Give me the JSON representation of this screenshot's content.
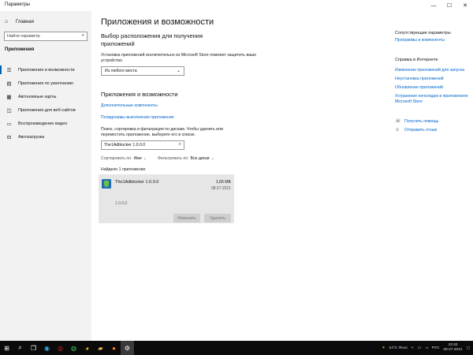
{
  "window": {
    "title": "Параметры",
    "minimize": "—",
    "maximize": "☐",
    "close": "✕"
  },
  "sidebar": {
    "home": "Главная",
    "search_placeholder": "Найти параметр",
    "section": "Приложения",
    "items": [
      {
        "label": "Приложения и возможности",
        "icon": "list-icon",
        "glyph": "☰",
        "active": true
      },
      {
        "label": "Приложения по умолчанию",
        "icon": "default-apps-icon",
        "glyph": "▤"
      },
      {
        "label": "Автономные карты",
        "icon": "map-icon",
        "glyph": "▦"
      },
      {
        "label": "Приложения для веб-сайтов",
        "icon": "web-icon",
        "glyph": "◫"
      },
      {
        "label": "Воспроизведение видео",
        "icon": "video-icon",
        "glyph": "▭"
      },
      {
        "label": "Автозагрузка",
        "icon": "startup-icon",
        "glyph": "⊟"
      }
    ]
  },
  "main": {
    "title": "Приложения и возможности",
    "location_heading": "Выбор расположения для получения приложений",
    "location_desc": "Установка приложений исключительно из Microsoft Store поможет защитить ваше устройство.",
    "location_value": "Из любого места",
    "apps_heading": "Приложения и возможности",
    "link_optional": "Дополнительные компоненты",
    "link_aliases": "Псевдонимы выполнения приложения",
    "search_desc": "Поиск, сортировка и фильтрация по дискам. Чтобы удалить или переместить приложение, выберите его в списке.",
    "search_value": "The1Adblocker 1.0.0.0",
    "sort_label": "Сортировать по:",
    "sort_value": "Имя",
    "filter_label": "Фильтровать по:",
    "filter_value": "Все диски",
    "found": "Найдено 1 приложение",
    "app": {
      "name": "The1Adblocker 1.0.0.0",
      "size": "1,65 МБ",
      "date": "08.07.2021",
      "version": "1.0.0.0",
      "modify": "Изменить",
      "remove": "Удалить"
    }
  },
  "right": {
    "related_heading": "Сопутствующие параметры",
    "related_link": "Программы и компоненты",
    "help_heading": "Справка в Интернете",
    "help_links": [
      "Изменение приложений для запуска",
      "Неустановка приложений",
      "Обновление приложений",
      "Устранение неполадок в приложениях Microsoft Store"
    ],
    "get_help": "Получить помощь",
    "feedback": "Отправить отзыв"
  },
  "taskbar": {
    "weather": "24°C Ясно",
    "lang": "РУС",
    "time": "23:40",
    "date": "08.07.2021"
  }
}
